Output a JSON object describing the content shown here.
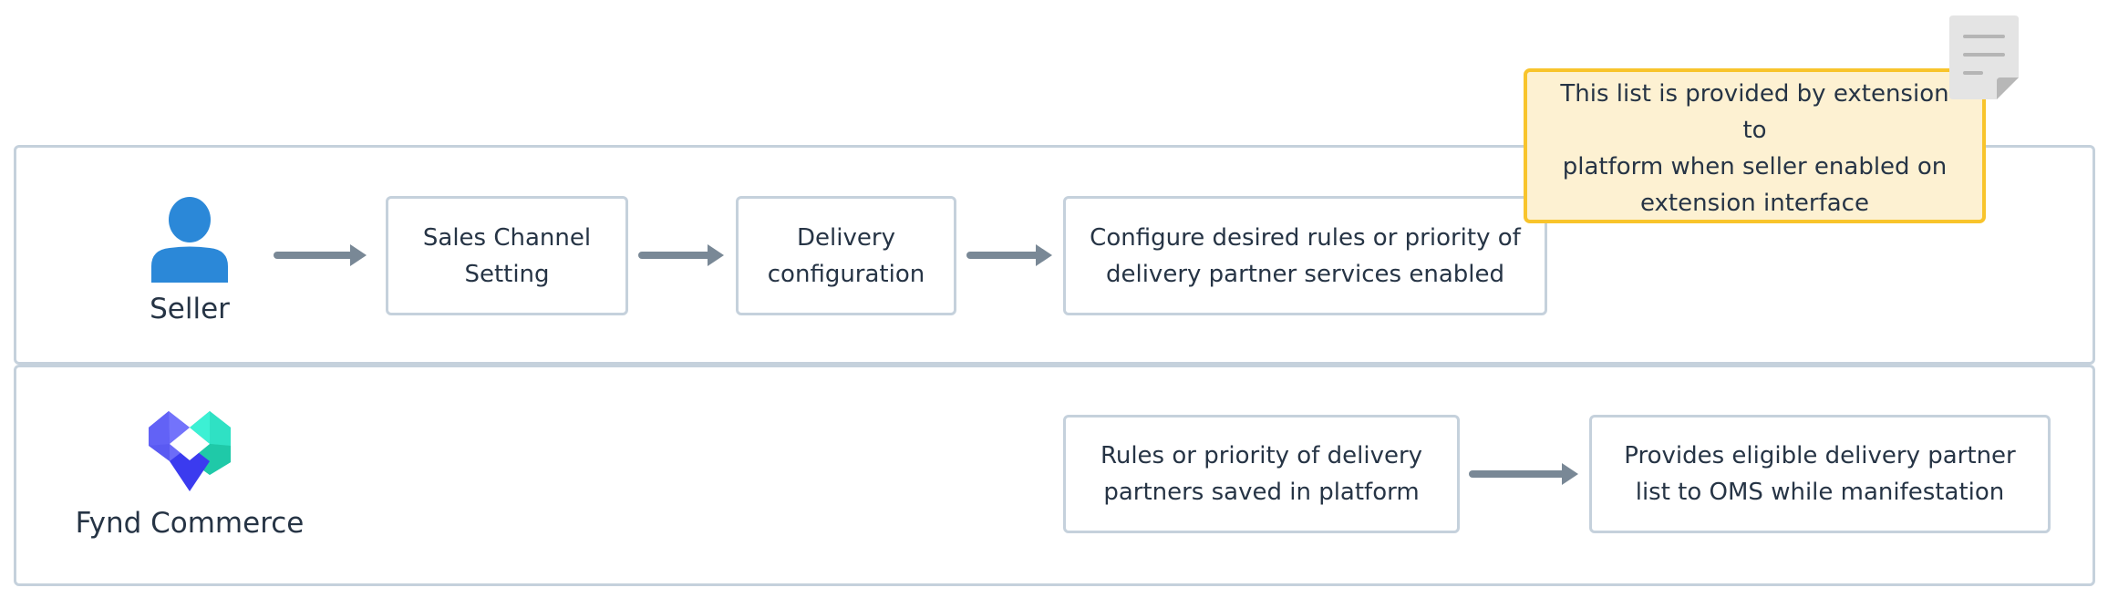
{
  "diagram": {
    "type": "swimlane-flow",
    "lanes": [
      {
        "id": "seller",
        "actor": {
          "label": "Seller",
          "icon": "user-icon",
          "color": "#2b88d8"
        },
        "steps": [
          {
            "lines": [
              "Sales Channel",
              "Setting"
            ]
          },
          {
            "lines": [
              "Delivery",
              "configuration"
            ]
          },
          {
            "lines": [
              "Configure desired rules or priority of",
              "delivery partner services enabled"
            ]
          }
        ]
      },
      {
        "id": "fynd-commerce",
        "actor": {
          "label": "Fynd Commerce",
          "icon": "fynd-logo-icon"
        },
        "steps": [
          {
            "lines": [
              "Rules or priority of delivery",
              "partners saved in platform"
            ]
          },
          {
            "lines": [
              "Provides eligible delivery partner",
              "list to OMS while manifestation"
            ]
          }
        ]
      }
    ],
    "note": {
      "icon": "note-document-icon",
      "lines": [
        "This list is provided by extension to",
        "platform when seller enabled on",
        "extension interface"
      ]
    },
    "colors": {
      "lane_border": "#c5d1dc",
      "arrow": "#798896",
      "text": "#263445",
      "note_fill": "#fdf1d2",
      "note_border": "#f8c42c",
      "seller_icon": "#2b88d8"
    }
  }
}
